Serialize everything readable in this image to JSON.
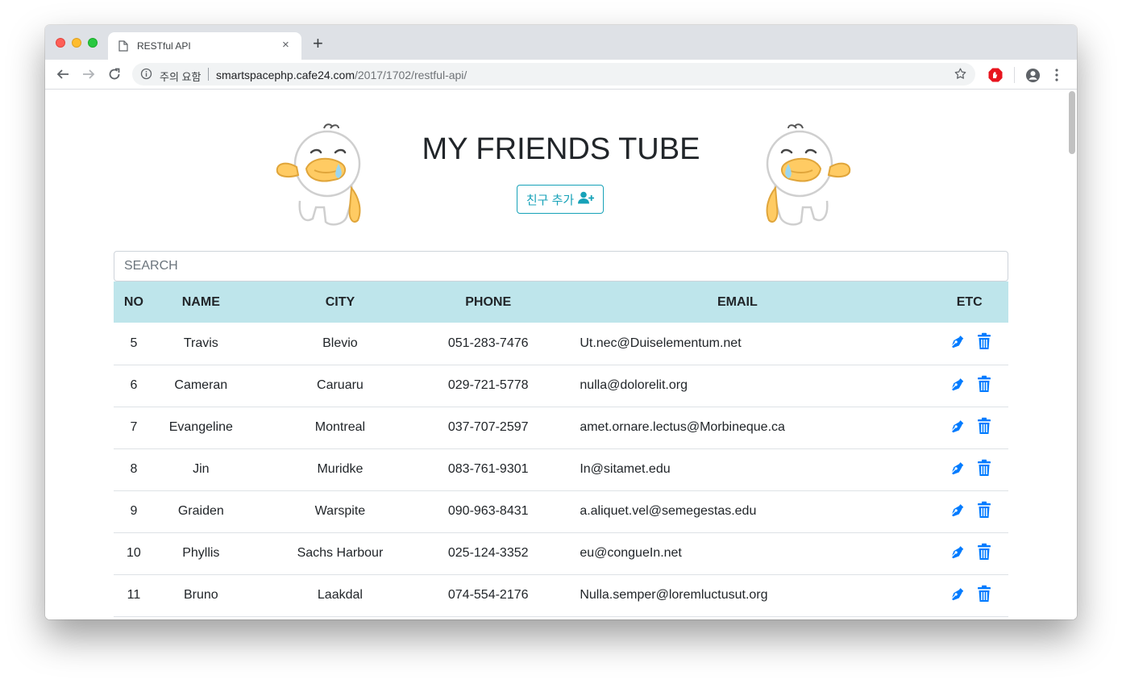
{
  "browser": {
    "tab_title": "RESTful API",
    "new_tab": "+",
    "close": "×",
    "security_label": "주의 요함",
    "url_host": "smartspacephp.cafe24.com",
    "url_path": "/2017/1702/restful-api/"
  },
  "page": {
    "title": "MY FRIENDS TUBE",
    "add_button_label": "친구 추가",
    "search_placeholder": "SEARCH"
  },
  "table": {
    "headers": [
      "NO",
      "NAME",
      "CITY",
      "PHONE",
      "EMAIL",
      "ETC"
    ],
    "rows": [
      {
        "no": "5",
        "name": "Travis",
        "city": "Blevio",
        "phone": "051-283-7476",
        "email": "Ut.nec@Duiselementum.net"
      },
      {
        "no": "6",
        "name": "Cameran",
        "city": "Caruaru",
        "phone": "029-721-5778",
        "email": "nulla@dolorelit.org"
      },
      {
        "no": "7",
        "name": "Evangeline",
        "city": "Montreal",
        "phone": "037-707-2597",
        "email": "amet.ornare.lectus@Morbineque.ca"
      },
      {
        "no": "8",
        "name": "Jin",
        "city": "Muridke",
        "phone": "083-761-9301",
        "email": "In@sitamet.edu"
      },
      {
        "no": "9",
        "name": "Graiden",
        "city": "Warspite",
        "phone": "090-963-8431",
        "email": "a.aliquet.vel@semegestas.edu"
      },
      {
        "no": "10",
        "name": "Phyllis",
        "city": "Sachs Harbour",
        "phone": "025-124-3352",
        "email": "eu@congueIn.net"
      },
      {
        "no": "11",
        "name": "Bruno",
        "city": "Laakdal",
        "phone": "074-554-2176",
        "email": "Nulla.semper@loremluctusut.org"
      }
    ]
  },
  "colors": {
    "accent_teal": "#17a2b8",
    "header_bg": "#bee5eb",
    "action_blue": "#007bff"
  },
  "icons": {
    "edit": "pen-nib-icon",
    "delete": "trash-icon",
    "add_user": "user-plus-icon"
  }
}
